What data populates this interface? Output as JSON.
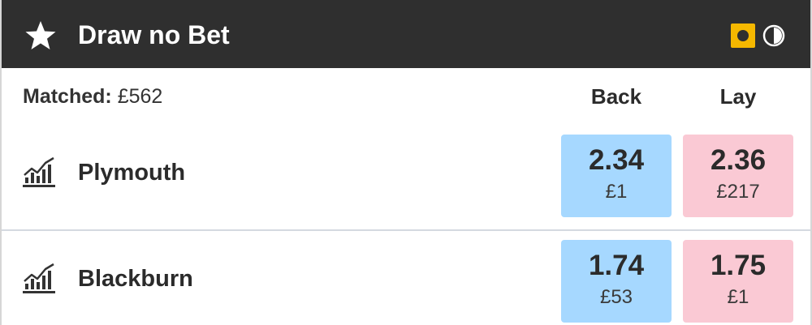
{
  "header": {
    "title": "Draw no Bet",
    "icons": {
      "favourite": "star-icon",
      "in_play": "in-play-icon",
      "timer": "timer-icon"
    },
    "colors": {
      "background": "#2f2f2f",
      "in_play": "#f5b800"
    }
  },
  "market": {
    "matched_label": "Matched:",
    "matched_value": "£562",
    "back_header": "Back",
    "lay_header": "Lay"
  },
  "runners": [
    {
      "name": "Plymouth",
      "icon": "chart-icon",
      "back": {
        "odds": "2.34",
        "stake": "£1"
      },
      "lay": {
        "odds": "2.36",
        "stake": "£217"
      }
    },
    {
      "name": "Blackburn",
      "icon": "chart-icon",
      "back": {
        "odds": "1.74",
        "stake": "£53"
      },
      "lay": {
        "odds": "1.75",
        "stake": "£1"
      }
    }
  ],
  "colors": {
    "back": "#a6d8ff",
    "lay": "#fac9d4",
    "divider": "#d4d9e0"
  }
}
